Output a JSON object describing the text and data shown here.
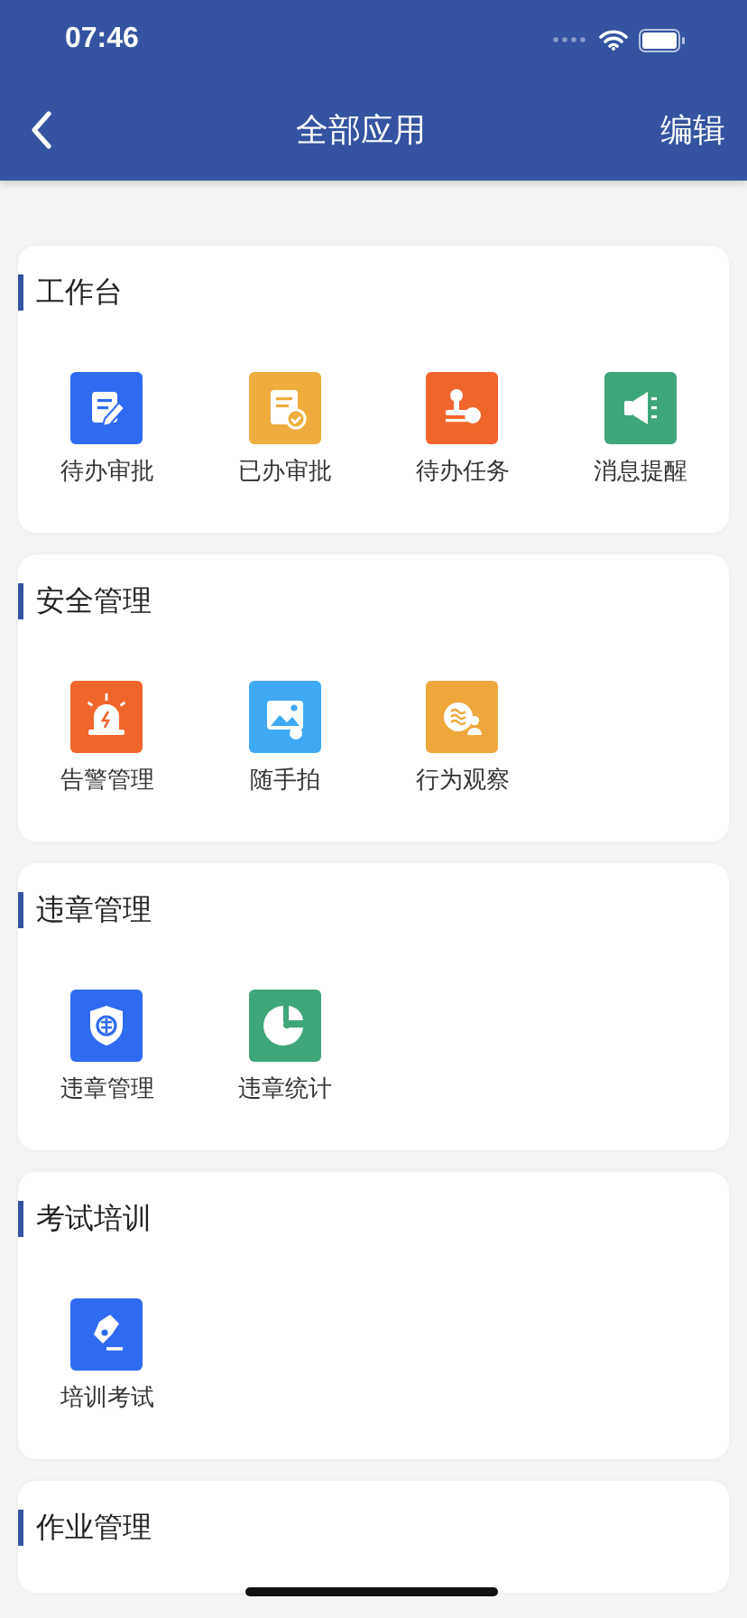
{
  "status_bar": {
    "time": "07:46"
  },
  "nav": {
    "title": "全部应用",
    "action": "编辑"
  },
  "sections": [
    {
      "title": "工作台",
      "apps": [
        {
          "label": "待办审批",
          "kind": "edit",
          "color": "#2f6bf0"
        },
        {
          "label": "已办审批",
          "kind": "doc-check",
          "color": "#efad3e"
        },
        {
          "label": "待办任务",
          "kind": "stamp",
          "color": "#f0652c"
        },
        {
          "label": "消息提醒",
          "kind": "megaphone",
          "color": "#3fa679"
        }
      ]
    },
    {
      "title": "安全管理",
      "apps": [
        {
          "label": "告警管理",
          "kind": "alarm",
          "color": "#f0652c"
        },
        {
          "label": "随手拍",
          "kind": "photo",
          "color": "#3fa9f5"
        },
        {
          "label": "行为观察",
          "kind": "observe",
          "color": "#eda73a"
        }
      ]
    },
    {
      "title": "违章管理",
      "apps": [
        {
          "label": "违章管理",
          "kind": "shield",
          "color": "#2f6bf0"
        },
        {
          "label": "违章统计",
          "kind": "pie",
          "color": "#3fa679"
        }
      ]
    },
    {
      "title": "考试培训",
      "apps": [
        {
          "label": "培训考试",
          "kind": "pen",
          "color": "#2f6bf0"
        }
      ]
    },
    {
      "title": "作业管理"
    }
  ]
}
